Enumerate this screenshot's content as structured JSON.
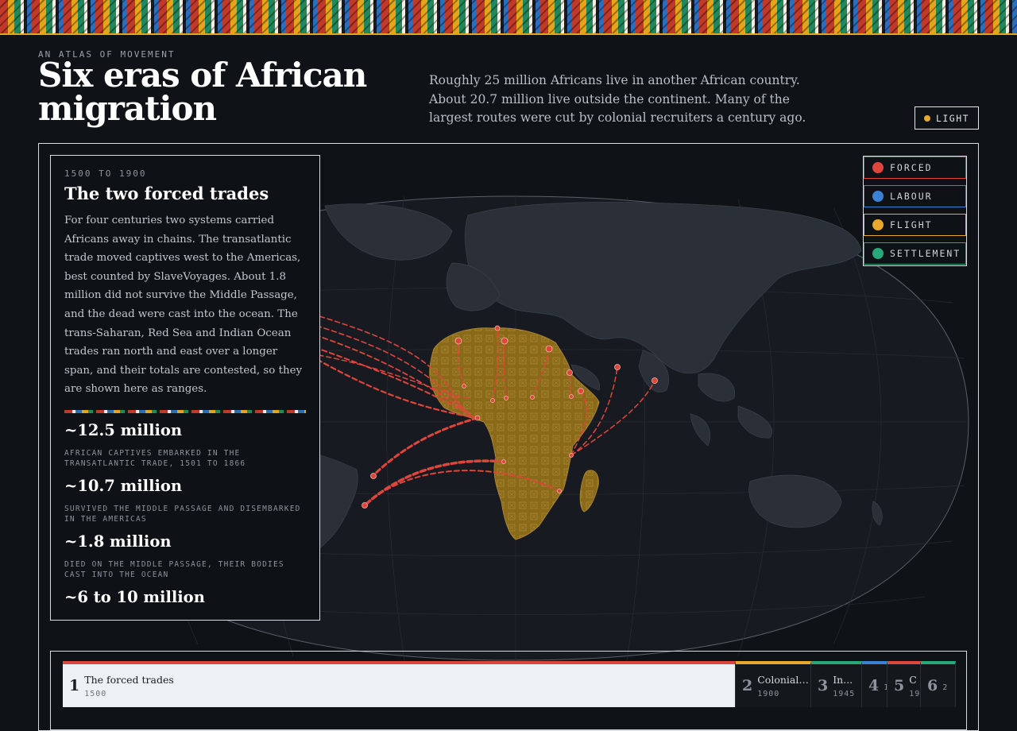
{
  "header": {
    "eyebrow": "AN ATLAS OF MOVEMENT",
    "title_line1": "Six eras of African",
    "title_line2": "migration",
    "intro": "Roughly 25 million Africans live in another African country. About 20.7 million live outside the continent. Many of the largest routes were cut by colonial recruiters a century ago.",
    "theme_toggle": "LIGHT"
  },
  "colors": {
    "forced": "#e0453c",
    "labour": "#3b82d4",
    "flight": "#e7a82b",
    "settlement": "#27a878",
    "africa": "#8a6a19",
    "land": "#2b3038"
  },
  "era": {
    "range": "1500 TO 1900",
    "title": "The two forced trades",
    "body": "For four centuries two systems carried Africans away in chains. The transatlantic trade moved captives west to the Americas, best counted by SlaveVoyages. About 1.8 million did not survive the Middle Passage, and the dead were cast into the ocean. The trans-Saharan, Red Sea and Indian Ocean trades ran north and east over a longer span, and their totals are contested, so they are shown here as ranges.",
    "stats": [
      {
        "value": "~12.5 million",
        "label": "AFRICAN CAPTIVES EMBARKED IN THE TRANSATLANTIC TRADE, 1501 TO 1866"
      },
      {
        "value": "~10.7 million",
        "label": "SURVIVED THE MIDDLE PASSAGE AND DISEMBARKED IN THE AMERICAS"
      },
      {
        "value": "~1.8 million",
        "label": "DIED ON THE MIDDLE PASSAGE, THEIR BODIES CAST INTO THE OCEAN"
      },
      {
        "value": "~6 to 10 million",
        "label": ""
      }
    ]
  },
  "legend": [
    {
      "label": "FORCED",
      "color": "#e0453c"
    },
    {
      "label": "LABOUR",
      "color": "#3b82d4"
    },
    {
      "label": "FLIGHT",
      "color": "#e7a82b"
    },
    {
      "label": "SETTLEMENT",
      "color": "#27a878"
    }
  ],
  "timeline": [
    {
      "num": "1",
      "label": "The forced trades",
      "year": "1500",
      "color": "#e0453c"
    },
    {
      "num": "2",
      "label": "Colonial ...",
      "year": "1900",
      "color": "#e7a82b"
    },
    {
      "num": "3",
      "label": "In...",
      "year": "1945",
      "color": "#27a878"
    },
    {
      "num": "4",
      "label": "",
      "year": "1",
      "color": "#3b82d4"
    },
    {
      "num": "5",
      "label": "C",
      "year": "19",
      "color": "#e0453c"
    },
    {
      "num": "6",
      "label": "",
      "year": "2",
      "color": "#27a878"
    }
  ]
}
